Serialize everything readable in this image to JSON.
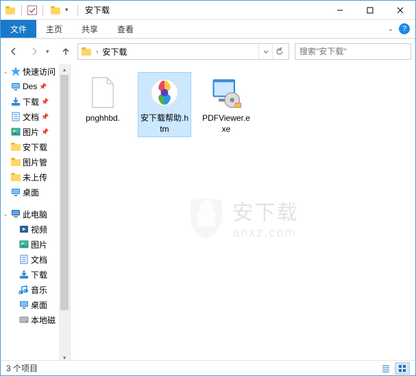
{
  "window": {
    "title": "安下载"
  },
  "ribbon": {
    "file": "文件",
    "home": "主页",
    "share": "共享",
    "view": "查看"
  },
  "addressbar": {
    "location": "安下载"
  },
  "search": {
    "placeholder": "搜索\"安下载\""
  },
  "sidebar": {
    "quickAccess": "快速访问",
    "items": [
      {
        "label": "Des",
        "icon": "desktop",
        "pinned": true
      },
      {
        "label": "下载",
        "icon": "downloads",
        "pinned": true
      },
      {
        "label": "文档",
        "icon": "documents",
        "pinned": true
      },
      {
        "label": "图片",
        "icon": "pictures",
        "pinned": true
      },
      {
        "label": "安下载",
        "icon": "folder",
        "pinned": false
      },
      {
        "label": "图片管",
        "icon": "folder",
        "pinned": false
      },
      {
        "label": "未上传",
        "icon": "folder",
        "pinned": false
      },
      {
        "label": "桌面",
        "icon": "desktop",
        "pinned": false
      }
    ],
    "thisPC": "此电脑",
    "pcItems": [
      {
        "label": "视频",
        "icon": "videos"
      },
      {
        "label": "图片",
        "icon": "pictures"
      },
      {
        "label": "文档",
        "icon": "documents"
      },
      {
        "label": "下载",
        "icon": "downloads"
      },
      {
        "label": "音乐",
        "icon": "music"
      },
      {
        "label": "桌面",
        "icon": "desktop"
      },
      {
        "label": "本地磁",
        "icon": "disk"
      }
    ]
  },
  "files": [
    {
      "name": "pnghhbd.",
      "type": "blank",
      "selected": false
    },
    {
      "name": "安下载帮助.htm",
      "type": "htm",
      "selected": true
    },
    {
      "name": "PDFViewer.exe",
      "type": "exe",
      "selected": false
    }
  ],
  "statusbar": {
    "count": "3 个项目"
  },
  "watermark": {
    "cn": "安下载",
    "en": "anxz.com"
  }
}
